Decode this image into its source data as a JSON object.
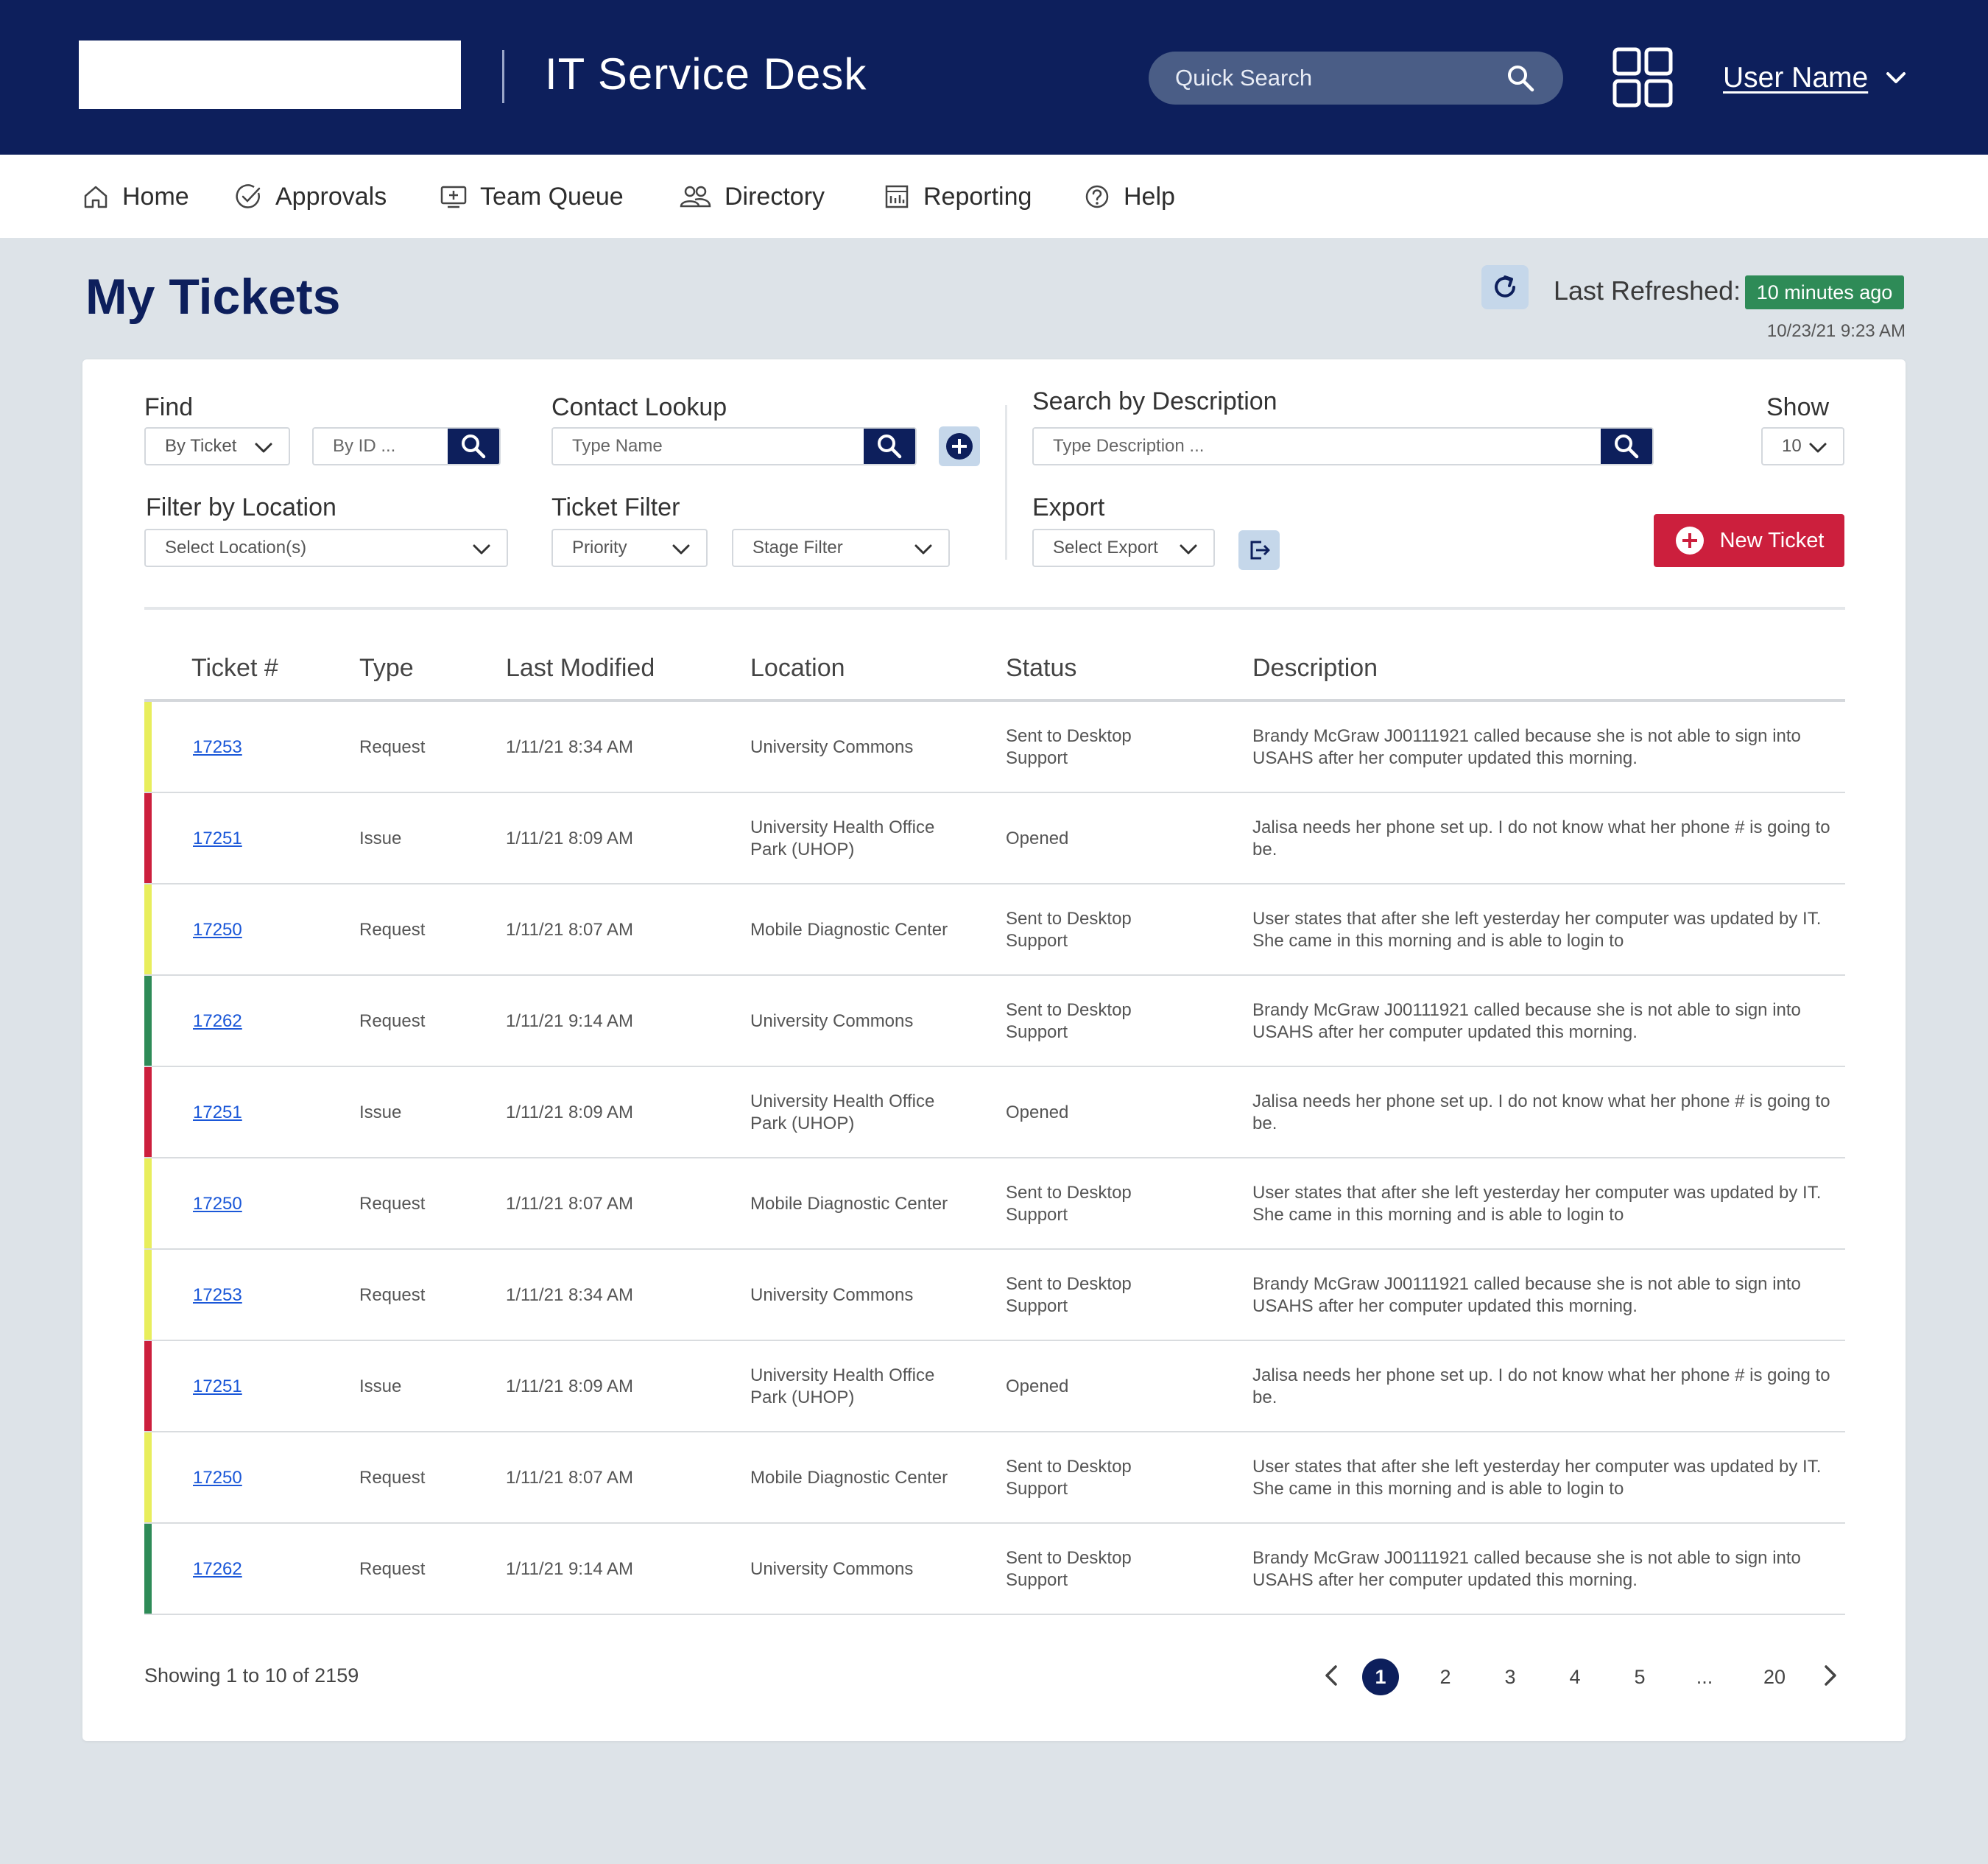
{
  "header": {
    "app_title": "IT Service Desk",
    "search_placeholder": "Quick Search",
    "user_name": "User Name",
    "colors": {
      "primary": "#0d1f5c",
      "danger": "#cc1f3d",
      "success": "#2e8b57"
    }
  },
  "nav": {
    "items": [
      {
        "label": "Home",
        "icon": "home-icon"
      },
      {
        "label": "Approvals",
        "icon": "check-circle-icon"
      },
      {
        "label": "Team Queue",
        "icon": "monitor-plus-icon"
      },
      {
        "label": "Directory",
        "icon": "people-icon"
      },
      {
        "label": "Reporting",
        "icon": "report-icon"
      },
      {
        "label": "Help",
        "icon": "help-circle-icon"
      }
    ]
  },
  "page": {
    "title": "My Tickets",
    "last_refreshed_label": "Last Refreshed:",
    "last_refreshed_badge": "10 minutes ago",
    "refresh_date": "10/23/21 9:23 AM"
  },
  "filters": {
    "find_label": "Find",
    "find_by": "By Ticket",
    "find_id_placeholder": "By ID ...",
    "contact_label": "Contact Lookup",
    "contact_placeholder": "Type Name",
    "desc_search_label": "Search by Description",
    "desc_search_placeholder": "Type Description ...",
    "show_label": "Show",
    "show_value": "10",
    "location_label": "Filter by Location",
    "location_value": "Select Location(s)",
    "ticket_filter_label": "Ticket Filter",
    "priority_value": "Priority",
    "stage_value": "Stage Filter",
    "export_label": "Export",
    "export_value": "Select Export",
    "new_ticket_label": "New Ticket"
  },
  "table": {
    "columns": [
      "Ticket #",
      "Type",
      "Last Modified",
      "Location",
      "Status",
      "Description"
    ],
    "rows": [
      {
        "id": "17253",
        "type": "Request",
        "modified": "1/11/21 8:34 AM",
        "location": "University Commons",
        "status": "Sent to Desktop Support",
        "description": "Brandy McGraw J00111921 called because she is not able to sign into USAHS after her computer updated this morning.",
        "color": "#e8ee5c"
      },
      {
        "id": "17251",
        "type": "Issue",
        "modified": "1/11/21 8:09 AM",
        "location": "University Health Office Park (UHOP)",
        "status": "Opened",
        "description": "Jalisa needs her phone set up. I do not know what her phone # is going to be.",
        "color": "#cc1f3d"
      },
      {
        "id": "17250",
        "type": "Request",
        "modified": "1/11/21 8:07 AM",
        "location": "Mobile Diagnostic Center",
        "status": "Sent to Desktop Support",
        "description": "User states that after she left yesterday her computer was updated by IT. She came in this morning and is able to login to",
        "color": "#e8ee5c"
      },
      {
        "id": "17262",
        "type": "Request",
        "modified": "1/11/21 9:14 AM",
        "location": "University Commons",
        "status": "Sent to Desktop Support",
        "description": "Brandy McGraw J00111921 called because she is not able to sign into USAHS after her computer updated this morning.",
        "color": "#2e8b57"
      },
      {
        "id": "17251",
        "type": "Issue",
        "modified": "1/11/21 8:09 AM",
        "location": "University Health Office Park (UHOP)",
        "status": "Opened",
        "description": "Jalisa needs her phone set up. I do not know what her phone # is going to be.",
        "color": "#cc1f3d"
      },
      {
        "id": "17250",
        "type": "Request",
        "modified": "1/11/21 8:07 AM",
        "location": "Mobile Diagnostic Center",
        "status": "Sent to Desktop Support",
        "description": "User states that after she left yesterday her computer was updated by IT. She came in this morning and is able to login to",
        "color": "#e8ee5c"
      },
      {
        "id": "17253",
        "type": "Request",
        "modified": "1/11/21 8:34 AM",
        "location": "University Commons",
        "status": "Sent to Desktop Support",
        "description": "Brandy McGraw J00111921 called because she is not able to sign into USAHS after her computer updated this morning.",
        "color": "#e8ee5c"
      },
      {
        "id": "17251",
        "type": "Issue",
        "modified": "1/11/21 8:09 AM",
        "location": "University Health Office Park (UHOP)",
        "status": "Opened",
        "description": "Jalisa needs her phone set up. I do not know what her phone # is going to be.",
        "color": "#cc1f3d"
      },
      {
        "id": "17250",
        "type": "Request",
        "modified": "1/11/21 8:07 AM",
        "location": "Mobile Diagnostic Center",
        "status": "Sent to Desktop Support",
        "description": "User states that after she left yesterday her computer was updated by IT. She came in this morning and is able to login to",
        "color": "#e8ee5c"
      },
      {
        "id": "17262",
        "type": "Request",
        "modified": "1/11/21 9:14 AM",
        "location": "University Commons",
        "status": "Sent to Desktop Support",
        "description": "Brandy McGraw J00111921 called because she is not able to sign into USAHS after her computer updated this morning.",
        "color": "#2e8b57"
      }
    ]
  },
  "footer": {
    "showing": "Showing 1 to 10 of 2159",
    "pages": [
      "1",
      "2",
      "3",
      "4",
      "5",
      "...",
      "20"
    ],
    "current_page": "1"
  }
}
